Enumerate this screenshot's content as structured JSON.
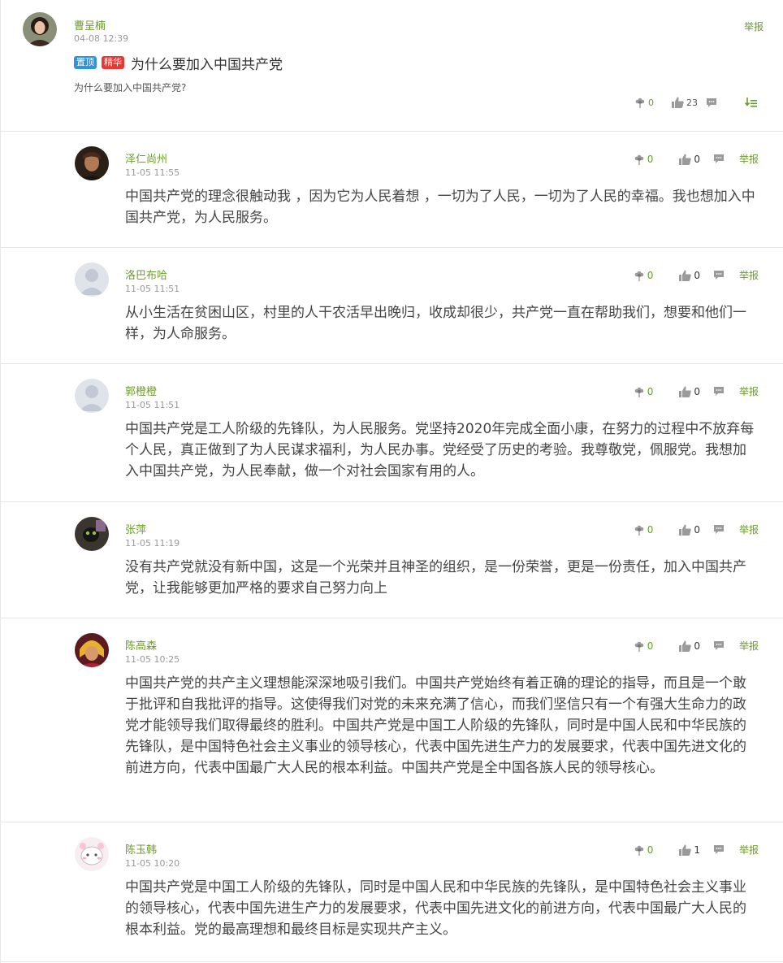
{
  "post": {
    "author": "曹呈楠",
    "time": "04-08 12:39",
    "report": "举报",
    "badge_top": "置顶",
    "badge_best": "精华",
    "title": "为什么要加入中国共产党",
    "desc": "为什么要加入中国共产党?",
    "flowers": "0",
    "likes": "23"
  },
  "replies": [
    {
      "author": "泽仁尚州",
      "time": "11-05 11:55",
      "flowers": "0",
      "likes": "0",
      "report": "举报",
      "content": "中国共产党的理念很触动我 ，因为它为人民着想 ，一切为了人民，一切为了人民的幸福。我也想加入中国共产党，为人民服务。"
    },
    {
      "author": "洛巴布哈",
      "time": "11-05 11:51",
      "flowers": "0",
      "likes": "0",
      "report": "举报",
      "content": "从小生活在贫困山区，村里的人干农活早出晚归，收成却很少，共产党一直在帮助我们，想要和他们一样，为人命服务。"
    },
    {
      "author": "郭橙橙",
      "time": "11-05 11:51",
      "flowers": "0",
      "likes": "0",
      "report": "举报",
      "content": "中国共产党是工人阶级的先锋队，为人民服务。党坚持2020年完成全面小康，在努力的过程中不放弃每个人民，真正做到了为人民谋求福利，为人民办事。党经受了历史的考验。我尊敬党，佩服党。我想加入中国共产党，为人民奉献，做一个对社会国家有用的人。"
    },
    {
      "author": "张萍",
      "time": "11-05 11:19",
      "flowers": "0",
      "likes": "0",
      "report": "举报",
      "content": "没有共产党就没有新中国，这是一个光荣并且神圣的组织，是一份荣誉，更是一份责任，加入中国共产党，让我能够更加严格的要求自己努力向上"
    },
    {
      "author": "陈高森",
      "time": "11-05 10:25",
      "flowers": "0",
      "likes": "0",
      "report": "举报",
      "content": "中国共产党的共产主义理想能深深地吸引我们。中国共产党始终有着正确的理论的指导，而且是一个敢于批评和自我批评的指导。这使得我们对党的未来充满了信心，而我们坚信只有一个有强大生命力的政党才能领导我们取得最终的胜利。中国共产党是中国工人阶级的先锋队，同时是中国人民和中华民族的先锋队，是中国特色社会主义事业的领导核心，代表中国先进生产力的发展要求，代表中国先进文化的前进方向，代表中国最广大人民的根本利益。中国共产党是全中国各族人民的领导核心。"
    },
    {
      "author": "陈玉韩",
      "time": "11-05 10:20",
      "flowers": "0",
      "likes": "1",
      "report": "举报",
      "content": "中国共产党是中国工人阶级的先锋队，同时是中国人民和中华民族的先锋队，是中国特色社会主义事业的领导核心，代表中国先进生产力的发展要求，代表中国先进文化的前进方向，代表中国最广大人民的根本利益。党的最高理想和最终目标是实现共产主义。"
    }
  ]
}
